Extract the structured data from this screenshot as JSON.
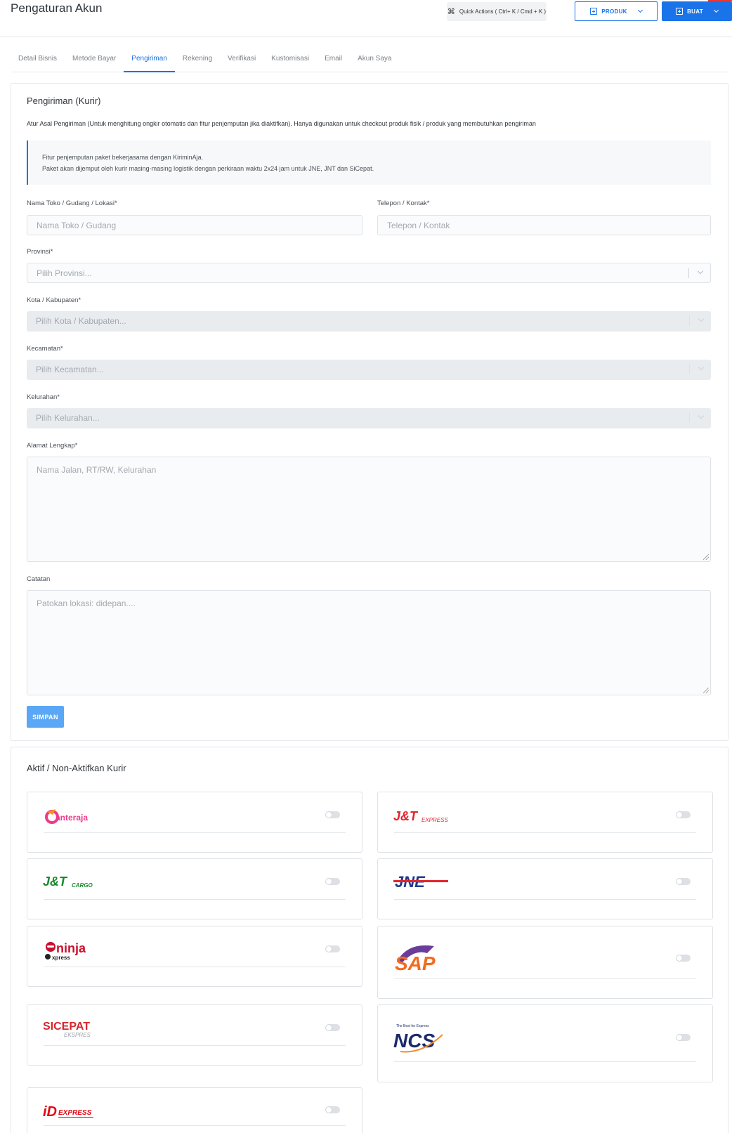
{
  "header": {
    "title": "Pengaturan Akun",
    "quick_actions_label": "Quick Actions ( Ctrl+ K / Cmd + K )",
    "product_button": "PRODUK",
    "create_button": "BUAT"
  },
  "tabs": [
    {
      "label": "Detail Bisnis",
      "active": false
    },
    {
      "label": "Metode Bayar",
      "active": false
    },
    {
      "label": "Pengiriman",
      "active": true
    },
    {
      "label": "Rekening",
      "active": false
    },
    {
      "label": "Verifikasi",
      "active": false
    },
    {
      "label": "Kustomisasi",
      "active": false
    },
    {
      "label": "Email",
      "active": false
    },
    {
      "label": "Akun Saya",
      "active": false
    }
  ],
  "shipping": {
    "title": "Pengiriman (Kurir)",
    "description": "Atur Asal Pengiriman (Untuk menghitung ongkir otomatis dan fitur penjemputan jika diaktifkan). Hanya digunakan untuk checkout produk fisik / produk yang membutuhkan pengiriman",
    "info_line1": "Fitur penjemputan paket bekerjasama dengan KiriminAja.",
    "info_line2": "Paket akan dijemput oleh kurir masing-masing logistik dengan perkiraan waktu 2x24 jam untuk JNE, JNT dan SiCepat.",
    "store_label": "Nama Toko / Gudang / Lokasi*",
    "store_placeholder": "Nama Toko / Gudang",
    "phone_label": "Telepon / Kontak*",
    "phone_placeholder": "Telepon / Kontak",
    "province_label": "Provinsi*",
    "province_placeholder": "Pilih Provinsi...",
    "city_label": "Kota / Kabupaten*",
    "city_placeholder": "Pilih Kota / Kabupaten...",
    "district_label": "Kecamatan*",
    "district_placeholder": "Pilih Kecamatan...",
    "village_label": "Kelurahan*",
    "village_placeholder": "Pilih Kelurahan...",
    "address_label": "Alamat Lengkap*",
    "address_placeholder": "Nama Jalan, RT/RW, Kelurahan",
    "notes_label": "Catatan",
    "notes_placeholder": "Patokan lokasi: didepan....",
    "save_button": "SIMPAN"
  },
  "couriers": {
    "title": "Aktif / Non-Aktifkan Kurir",
    "items": [
      {
        "name": "anteraja",
        "enabled": false
      },
      {
        "name": "J&T EXPRESS",
        "enabled": false
      },
      {
        "name": "J&T CARGO",
        "enabled": false
      },
      {
        "name": "JNE",
        "enabled": false
      },
      {
        "name": "ninja xpress",
        "enabled": false
      },
      {
        "name": "SAP",
        "enabled": false
      },
      {
        "name": "SICEPAT EKSPRES",
        "enabled": false
      },
      {
        "name": "NCS",
        "enabled": false
      },
      {
        "name": "iD EXPRESS",
        "enabled": false
      }
    ],
    "logo_text": {
      "anteraja": "anteraja",
      "jt_main": "J&T",
      "jt_express": "EXPRESS",
      "jt_cargo": "CARGO",
      "jne": "JNE",
      "ninja": "ninja",
      "xpress": "xpress",
      "sap": "SAP",
      "sicepat": "SICEPAT",
      "ekspres": "EKSPRES",
      "ncs_tagline": "The Best for Express",
      "ncs": "NCS",
      "id": "iD",
      "id_express": "EXPRESS"
    }
  },
  "colors": {
    "primary": "#1a73e8",
    "save_button": "#5aa7f5",
    "anteraja": "#ee3a8c",
    "jt_red": "#e3242b",
    "jt_green": "#1a8a2e",
    "jne_blue": "#1f3a8f",
    "ninja_red": "#c8102e",
    "sap_orange": "#f26b21",
    "sap_purple": "#6a3d9a",
    "sicepat_red": "#d7262d",
    "ncs_navy": "#1b2a6b",
    "idexpress_red": "#e30613"
  }
}
